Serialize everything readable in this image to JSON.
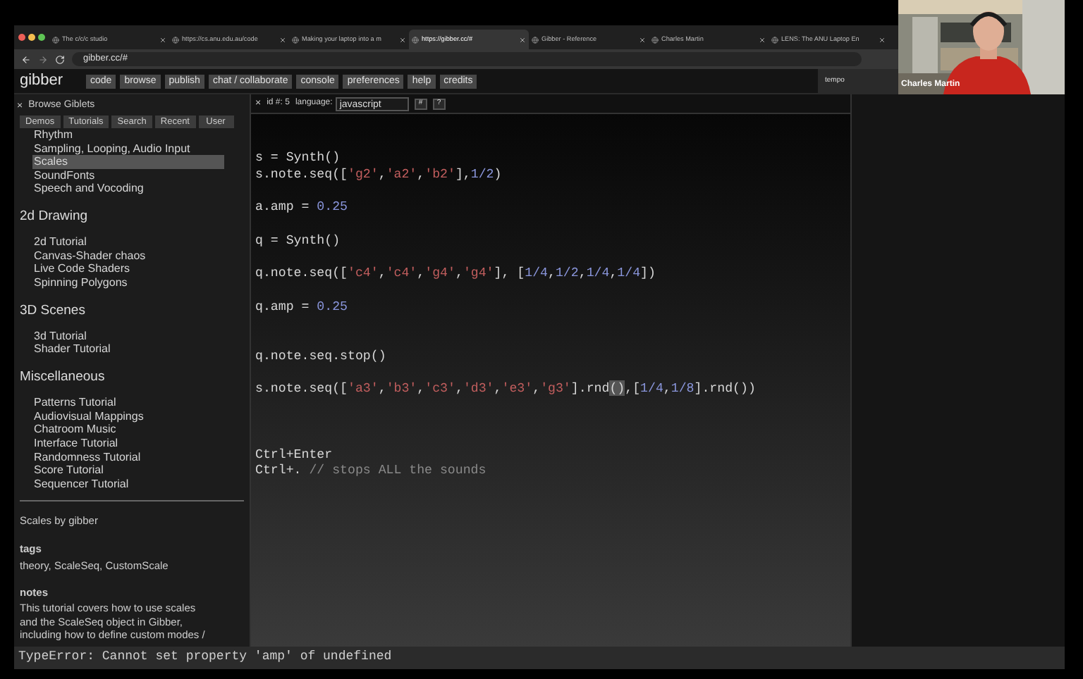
{
  "browser": {
    "tabs": [
      {
        "title": "The c/c/c studio",
        "selected": false
      },
      {
        "title": "https://cs.anu.edu.au/code",
        "selected": false
      },
      {
        "title": "Making your laptop into a m",
        "selected": false
      },
      {
        "title": "https://gibber.cc/#",
        "selected": true
      },
      {
        "title": "Gibber - Reference",
        "selected": false
      },
      {
        "title": "Charles Martin",
        "selected": false
      },
      {
        "title": "LENS: The ANU Laptop En",
        "selected": false
      }
    ],
    "url": "gibber.cc/#"
  },
  "menu": {
    "logo": "gibber",
    "items": [
      "code",
      "browse",
      "publish",
      "chat / collaborate",
      "console",
      "preferences",
      "help",
      "credits"
    ],
    "tempo": "tempo"
  },
  "sidebar": {
    "close": "×",
    "title": "Browse Giblets",
    "tabs": [
      "Demos",
      "Tutorials",
      "Search",
      "Recent",
      "User"
    ],
    "sections": [
      {
        "items": [
          {
            "label": "Rhythm",
            "selected": false
          },
          {
            "label": "Sampling, Looping, Audio Input",
            "selected": false
          },
          {
            "label": "Scales",
            "selected": true
          },
          {
            "label": "SoundFonts",
            "selected": false
          },
          {
            "label": "Speech and Vocoding",
            "selected": false
          }
        ]
      },
      {
        "heading": "2d Drawing",
        "items": [
          {
            "label": "2d Tutorial",
            "selected": false
          },
          {
            "label": "Canvas-Shader chaos",
            "selected": false
          },
          {
            "label": "Live Code Shaders",
            "selected": false
          },
          {
            "label": "Spinning Polygons",
            "selected": false
          }
        ]
      },
      {
        "heading": "3D Scenes",
        "items": [
          {
            "label": "3d Tutorial",
            "selected": false
          },
          {
            "label": "Shader Tutorial",
            "selected": false
          }
        ]
      },
      {
        "heading": "Miscellaneous",
        "items": [
          {
            "label": "Patterns Tutorial",
            "selected": false
          },
          {
            "label": "Audiovisual Mappings",
            "selected": false
          },
          {
            "label": "Chatroom Music",
            "selected": false
          },
          {
            "label": "Interface Tutorial",
            "selected": false
          },
          {
            "label": "Randomness Tutorial",
            "selected": false
          },
          {
            "label": "Score Tutorial",
            "selected": false
          },
          {
            "label": "Sequencer Tutorial",
            "selected": false
          }
        ]
      }
    ],
    "info": {
      "title": "Scales by gibber",
      "tags_label": "tags",
      "tags": "theory, ScaleSeq, CustomScale",
      "notes_label": "notes",
      "notes": "This tutorial covers how to use scales and the ScaleSeq object in Gibber, including how to define custom modes /"
    }
  },
  "editor": {
    "close": "×",
    "id": "id #: 5",
    "language_label": "language:",
    "language": "javascript",
    "buttons": [
      "#",
      "?"
    ],
    "lines": [
      {
        "kind": "blank"
      },
      {
        "kind": "blank"
      },
      {
        "kind": "code",
        "tokens": [
          {
            "kind": "plain",
            "text": "s = Synth()"
          }
        ]
      },
      {
        "kind": "code",
        "tokens": [
          {
            "kind": "plain",
            "text": "s.note.seq(["
          },
          {
            "kind": "string",
            "text": "'g2'",
            "after": ","
          },
          {
            "kind": "string",
            "text": "'a2'",
            "after": ","
          },
          {
            "kind": "string",
            "text": "'b2'",
            "after": "],"
          },
          {
            "kind": "number",
            "text": "1/2",
            "after": ")"
          }
        ]
      },
      {
        "kind": "blank"
      },
      {
        "kind": "code",
        "tokens": [
          {
            "kind": "plain",
            "text": "a.amp = "
          },
          {
            "kind": "number",
            "text": "0.25"
          }
        ]
      },
      {
        "kind": "blank"
      },
      {
        "kind": "code",
        "tokens": [
          {
            "kind": "plain",
            "text": "q = Synth()"
          }
        ]
      },
      {
        "kind": "blank"
      },
      {
        "kind": "code",
        "tokens": [
          {
            "kind": "plain",
            "text": "q.note.seq(["
          },
          {
            "kind": "string",
            "text": "'c4'",
            "after": ","
          },
          {
            "kind": "string",
            "text": "'c4'",
            "after": ","
          },
          {
            "kind": "string",
            "text": "'g4'",
            "after": ","
          },
          {
            "kind": "string",
            "text": "'g4'",
            "after": "], ["
          },
          {
            "kind": "number",
            "text": "1/4",
            "after": ","
          },
          {
            "kind": "number",
            "text": "1/2",
            "after": ","
          },
          {
            "kind": "number",
            "text": "1/4",
            "after": ","
          },
          {
            "kind": "number",
            "text": "1/4",
            "after": "])"
          }
        ]
      },
      {
        "kind": "blank"
      },
      {
        "kind": "code",
        "tokens": [
          {
            "kind": "plain",
            "text": "q.amp = "
          },
          {
            "kind": "number",
            "text": "0.25"
          }
        ]
      },
      {
        "kind": "blank"
      },
      {
        "kind": "blank"
      },
      {
        "kind": "code",
        "tokens": [
          {
            "kind": "plain",
            "text": "q.note.seq.stop()"
          }
        ]
      },
      {
        "kind": "blank"
      },
      {
        "kind": "code",
        "tokens": [
          {
            "kind": "plain",
            "text": "s.note.seq(["
          },
          {
            "kind": "string",
            "text": "'a3'",
            "after": ","
          },
          {
            "kind": "string",
            "text": "'b3'",
            "after": ","
          },
          {
            "kind": "string",
            "text": "'c3'",
            "after": ","
          },
          {
            "kind": "string",
            "text": "'d3'",
            "after": ","
          },
          {
            "kind": "string",
            "text": "'e3'",
            "after": ","
          },
          {
            "kind": "string",
            "text": "'g3'",
            "after": "].rnd"
          },
          {
            "kind": "match",
            "text": "()",
            "after": ",["
          },
          {
            "kind": "number",
            "text": "1/4",
            "after": ","
          },
          {
            "kind": "number",
            "text": "1/8",
            "after": "].rnd())"
          }
        ]
      },
      {
        "kind": "blank"
      },
      {
        "kind": "blank"
      },
      {
        "kind": "blank"
      },
      {
        "kind": "code",
        "tokens": [
          {
            "kind": "plain",
            "text": "Ctrl+Enter"
          }
        ]
      },
      {
        "kind": "code",
        "tokens": [
          {
            "kind": "plain",
            "text": "Ctrl+. "
          },
          {
            "kind": "comment",
            "text": "// stops ALL the sounds"
          }
        ]
      }
    ]
  },
  "console": {
    "message": "TypeError: Cannot set property 'amp' of undefined"
  },
  "webcam": {
    "name": "Charles Martin"
  }
}
